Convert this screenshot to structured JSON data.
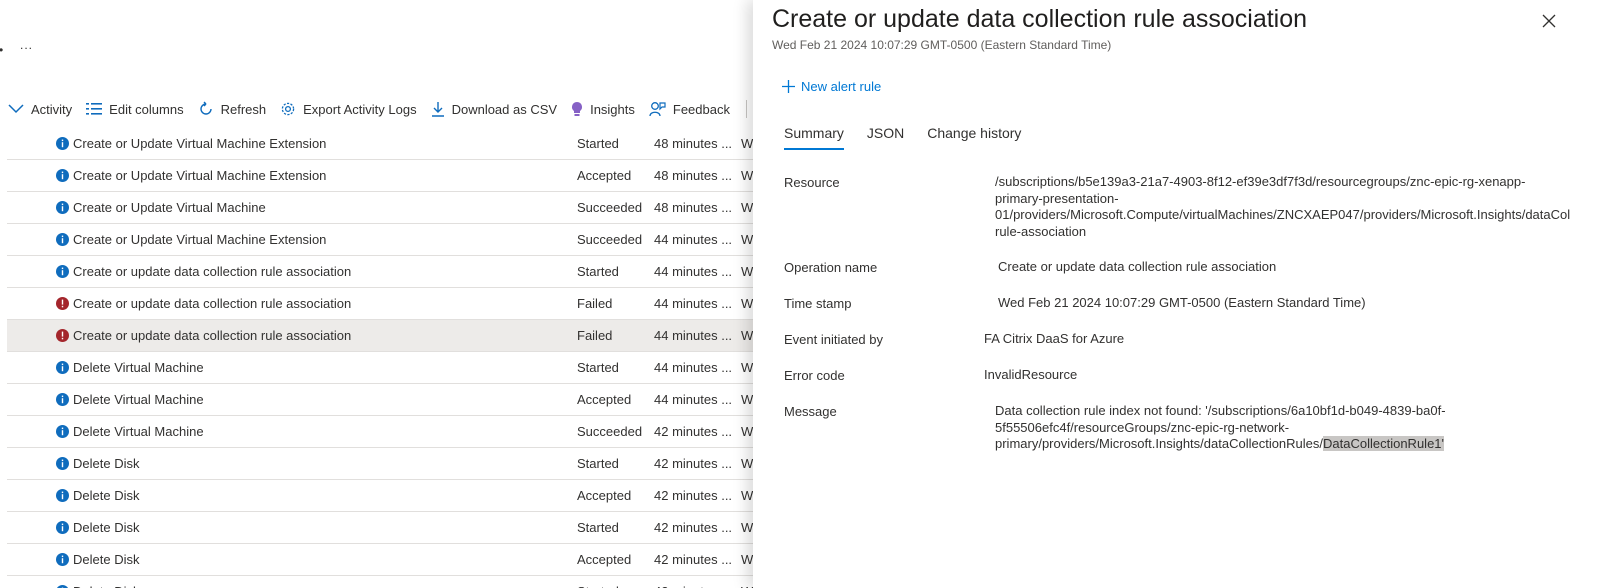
{
  "left": {
    "more_label": "...",
    "toolbar": {
      "activity": "Activity",
      "edit_columns": "Edit columns",
      "refresh": "Refresh",
      "export": "Export Activity Logs",
      "download": "Download as CSV",
      "insights": "Insights",
      "feedback": "Feedback"
    },
    "rows": [
      {
        "name": "Create or Update Virtual Machine Extension",
        "status": "Started",
        "time": "48 minutes ...",
        "extra": "W",
        "level": "info"
      },
      {
        "name": "Create or Update Virtual Machine Extension",
        "status": "Accepted",
        "time": "48 minutes ...",
        "extra": "W",
        "level": "info"
      },
      {
        "name": "Create or Update Virtual Machine",
        "status": "Succeeded",
        "time": "48 minutes ...",
        "extra": "W",
        "level": "info"
      },
      {
        "name": "Create or Update Virtual Machine Extension",
        "status": "Succeeded",
        "time": "44 minutes ...",
        "extra": "W",
        "level": "info"
      },
      {
        "name": "Create or update data collection rule association",
        "status": "Started",
        "time": "44 minutes ...",
        "extra": "W",
        "level": "info"
      },
      {
        "name": "Create or update data collection rule association",
        "status": "Failed",
        "time": "44 minutes ...",
        "extra": "W",
        "level": "error"
      },
      {
        "name": "Create or update data collection rule association",
        "status": "Failed",
        "time": "44 minutes ...",
        "extra": "W",
        "level": "error",
        "selected": true
      },
      {
        "name": "Delete Virtual Machine",
        "status": "Started",
        "time": "44 minutes ...",
        "extra": "W",
        "level": "info"
      },
      {
        "name": "Delete Virtual Machine",
        "status": "Accepted",
        "time": "44 minutes ...",
        "extra": "W",
        "level": "info"
      },
      {
        "name": "Delete Virtual Machine",
        "status": "Succeeded",
        "time": "42 minutes ...",
        "extra": "W",
        "level": "info"
      },
      {
        "name": "Delete Disk",
        "status": "Started",
        "time": "42 minutes ...",
        "extra": "W",
        "level": "info"
      },
      {
        "name": "Delete Disk",
        "status": "Accepted",
        "time": "42 minutes ...",
        "extra": "W",
        "level": "info"
      },
      {
        "name": "Delete Disk",
        "status": "Started",
        "time": "42 minutes ...",
        "extra": "W",
        "level": "info"
      },
      {
        "name": "Delete Disk",
        "status": "Accepted",
        "time": "42 minutes ...",
        "extra": "W",
        "level": "info"
      },
      {
        "name": "Delete Disk",
        "status": "Started",
        "time": "42 minutes ...",
        "extra": "W",
        "level": "info"
      }
    ]
  },
  "panel": {
    "title": "Create or update data collection rule association",
    "subtitle": "Wed Feb 21 2024 10:07:29 GMT-0500 (Eastern Standard Time)",
    "new_alert": "New alert rule",
    "tabs": [
      "Summary",
      "JSON",
      "Change history"
    ],
    "properties": {
      "resource_label": "Resource",
      "resource_lines": [
        "/subscriptions/b5e139a3-21a7-4903-8f12-ef39e3df7f3d/resourcegroups/znc-epic-rg-xenapp-",
        "primary-presentation-",
        "01/providers/Microsoft.Compute/virtualMachines/ZNCXAEP047/providers/Microsoft.Insights/dataCol",
        "rule-association"
      ],
      "operation_label": "Operation name",
      "operation_value": "Create or update data collection rule association",
      "timestamp_label": "Time stamp",
      "timestamp_value": "Wed Feb 21 2024 10:07:29 GMT-0500 (Eastern Standard Time)",
      "initiated_label": "Event initiated by",
      "initiated_value": "FA Citrix DaaS for Azure",
      "error_label": "Error code",
      "error_value": "InvalidResource",
      "message_label": "Message",
      "message_line1": "Data collection rule index not found: '/subscriptions/6a10bf1d-b049-4839-ba0f-",
      "message_line2": "5f55506efc4f/resourceGroups/znc-epic-rg-network-",
      "message_line3_prefix": "primary/providers/Microsoft.Insights/dataCollectionRules/",
      "message_line3_highlight": "DataCollectionRule1'"
    }
  },
  "colors": {
    "accent": "#0078d4",
    "info": "#0f6cbd",
    "error": "#a4262c",
    "selected_row": "#edebe9"
  }
}
